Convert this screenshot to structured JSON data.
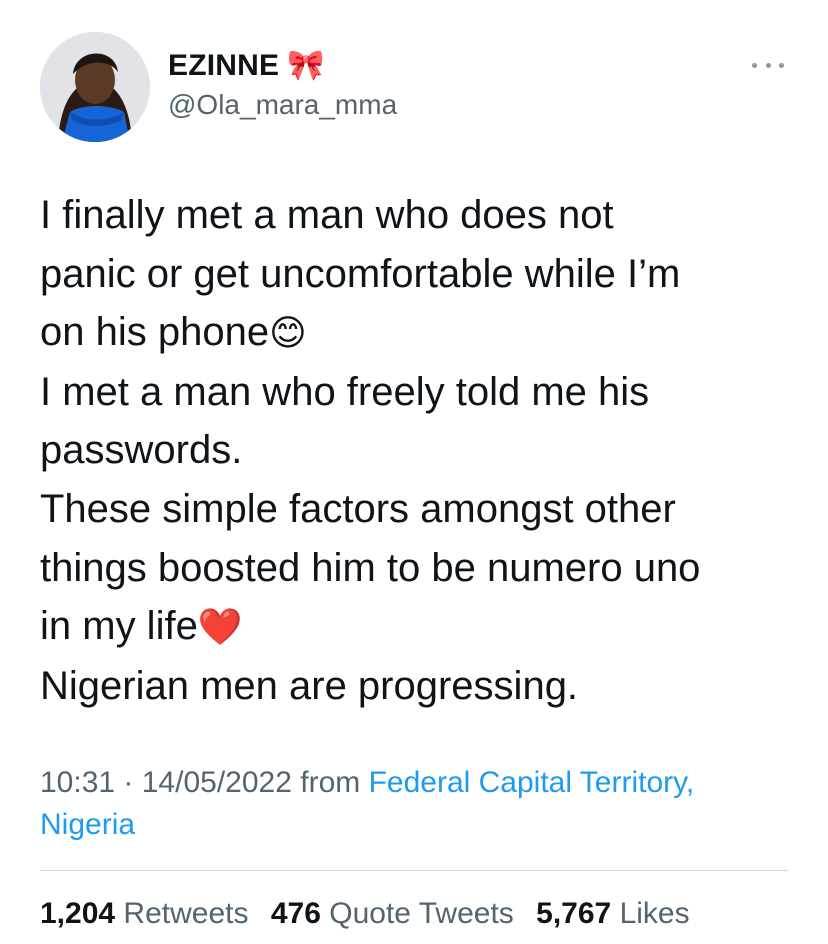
{
  "author": {
    "display_name": "EZINNE",
    "name_emoji": "🎀",
    "handle": "@Ola_mara_mma"
  },
  "tweet": {
    "lines": [
      "I finally met a man who does not",
      "panic or get uncomfortable while I’m",
      "on his phone",
      "I met a man who freely told me his",
      "passwords.",
      "These simple factors amongst other",
      "things boosted him to be numero uno",
      "in my life",
      "Nigerian men are progressing."
    ],
    "emoji_smile": "😊",
    "emoji_heart": "❤️"
  },
  "meta": {
    "time": "10:31",
    "separator": " · ",
    "date": "14/05/2022",
    "from_label": " from ",
    "location_line1": "Federal Capital Territory,",
    "location_line2": "Nigeria"
  },
  "stats": {
    "retweets_count": "1,204",
    "retweets_label": "Retweets",
    "quotes_count": "476",
    "quotes_label": "Quote Tweets",
    "likes_count": "5,767",
    "likes_label": "Likes"
  },
  "colors": {
    "text_primary": "#0f1419",
    "text_secondary": "#536471",
    "link": "#1d9bf0",
    "divider": "#cfd9de"
  },
  "icons": {
    "more": "more-horizontal-icon",
    "bow": "ribbon-bow-icon"
  }
}
